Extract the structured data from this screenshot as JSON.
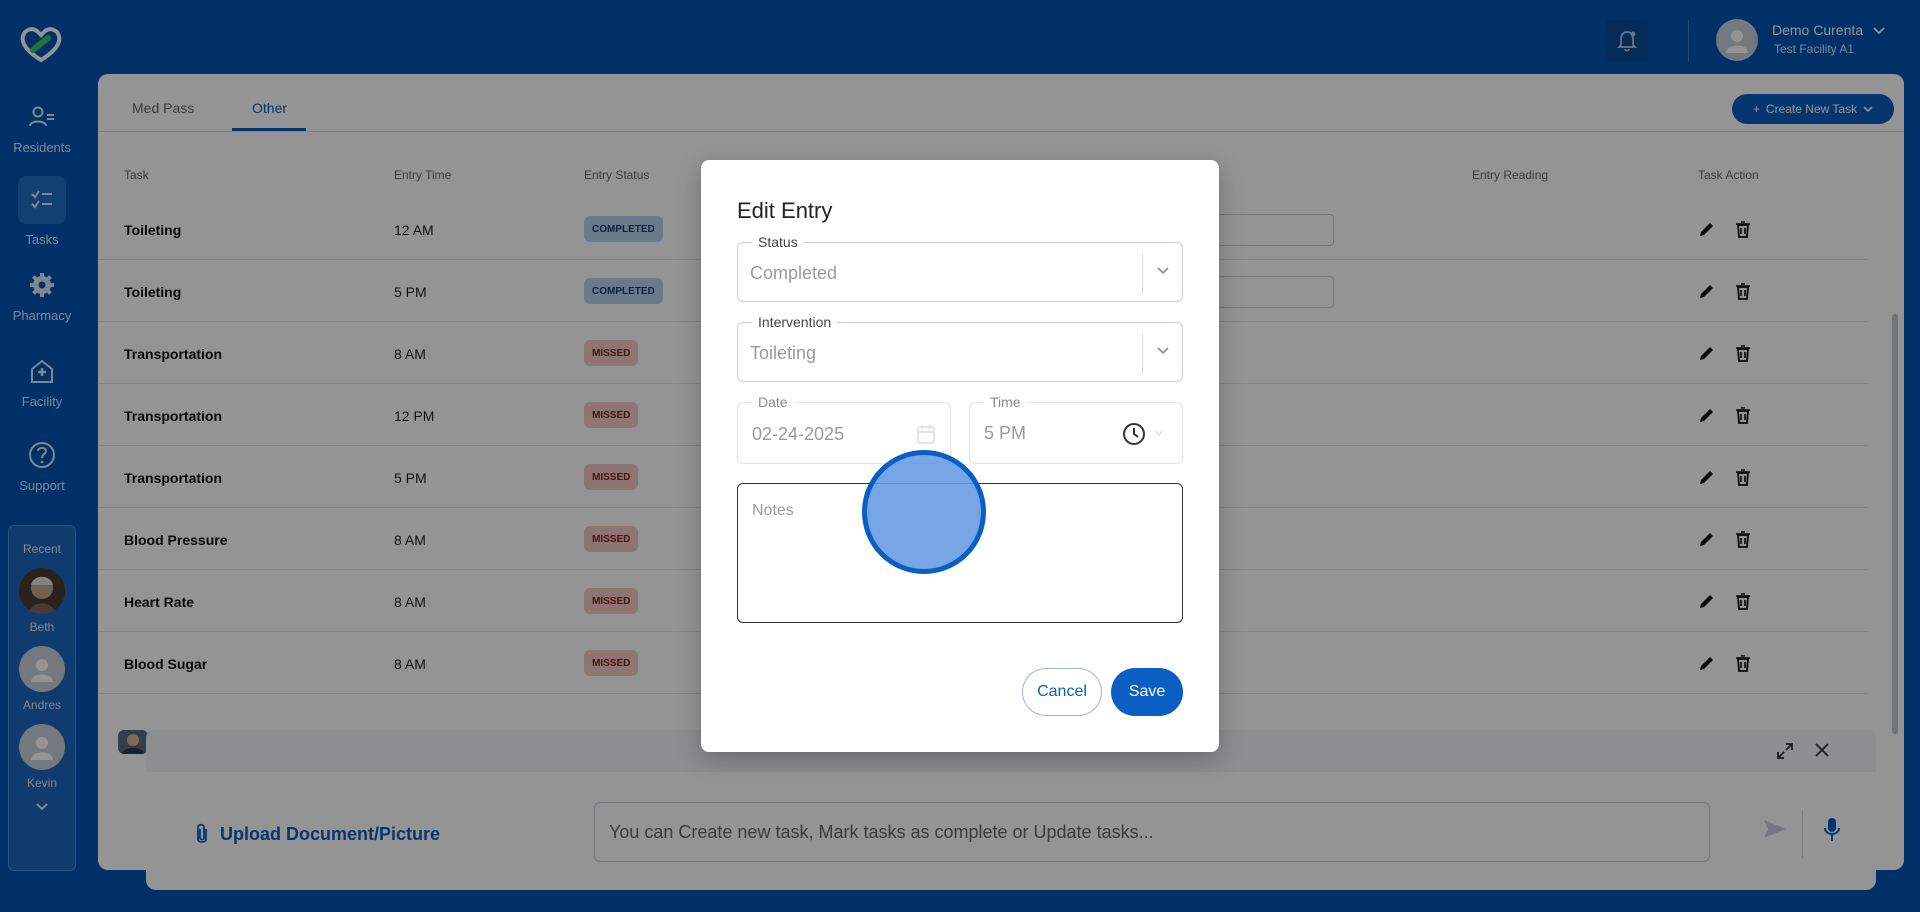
{
  "app": {
    "colors": {
      "brand": "#0053b3",
      "accent": "#0b5ec2",
      "completed": "#b9d3f0",
      "missed": "#f6c8c8"
    }
  },
  "nav": {
    "items": [
      {
        "label": "Residents",
        "icon": "residents-icon"
      },
      {
        "label": "Tasks",
        "icon": "tasks-icon"
      },
      {
        "label": "Pharmacy",
        "icon": "gear-icon"
      },
      {
        "label": "Facility",
        "icon": "facility-icon"
      },
      {
        "label": "Support",
        "icon": "help-icon"
      }
    ],
    "recent": {
      "title": "Recent",
      "people": [
        {
          "name": "Beth"
        },
        {
          "name": "Andres"
        },
        {
          "name": "Kevin"
        }
      ]
    }
  },
  "header": {
    "user_name": "Demo Curenta",
    "facility": "Test Facility A1"
  },
  "tabs": [
    {
      "label": "Med Pass"
    },
    {
      "label": "Other"
    }
  ],
  "create_button": "Create New Task",
  "table": {
    "headers": {
      "task": "Task",
      "entry_time": "Entry Time",
      "entry_status": "Entry Status",
      "entry_reading": "Entry Reading",
      "task_action": "Task Action"
    },
    "rows": [
      {
        "task": "Toileting",
        "time": "12 AM",
        "status": "COMPLETED",
        "status_type": "completed",
        "has_entry_box": true
      },
      {
        "task": "Toileting",
        "time": "5 PM",
        "status": "COMPLETED",
        "status_type": "completed",
        "has_entry_box": true
      },
      {
        "task": "Transportation",
        "time": "8 AM",
        "status": "MISSED",
        "status_type": "missed",
        "has_entry_box": false
      },
      {
        "task": "Transportation",
        "time": "12 PM",
        "status": "MISSED",
        "status_type": "missed",
        "has_entry_box": false
      },
      {
        "task": "Transportation",
        "time": "5 PM",
        "status": "MISSED",
        "status_type": "missed",
        "has_entry_box": false
      },
      {
        "task": "Blood Pressure",
        "time": "8 AM",
        "status": "MISSED",
        "status_type": "missed",
        "has_entry_box": false
      },
      {
        "task": "Heart Rate",
        "time": "8 AM",
        "status": "MISSED",
        "status_type": "missed",
        "has_entry_box": false
      },
      {
        "task": "Blood Sugar",
        "time": "8 AM",
        "status": "MISSED",
        "status_type": "missed",
        "has_entry_box": false
      }
    ]
  },
  "chat": {
    "upload_label": "Upload Document/Picture",
    "input_placeholder": "You can Create new task, Mark tasks as complete or Update tasks..."
  },
  "modal": {
    "title": "Edit Entry",
    "status": {
      "label": "Status",
      "value": "Completed"
    },
    "intervention": {
      "label": "Intervention",
      "value": "Toileting"
    },
    "date": {
      "label": "Date",
      "value": "02-24-2025"
    },
    "time": {
      "label": "Time",
      "value": "5 PM"
    },
    "notes": {
      "placeholder": "Notes"
    },
    "cancel_label": "Cancel",
    "save_label": "Save"
  }
}
